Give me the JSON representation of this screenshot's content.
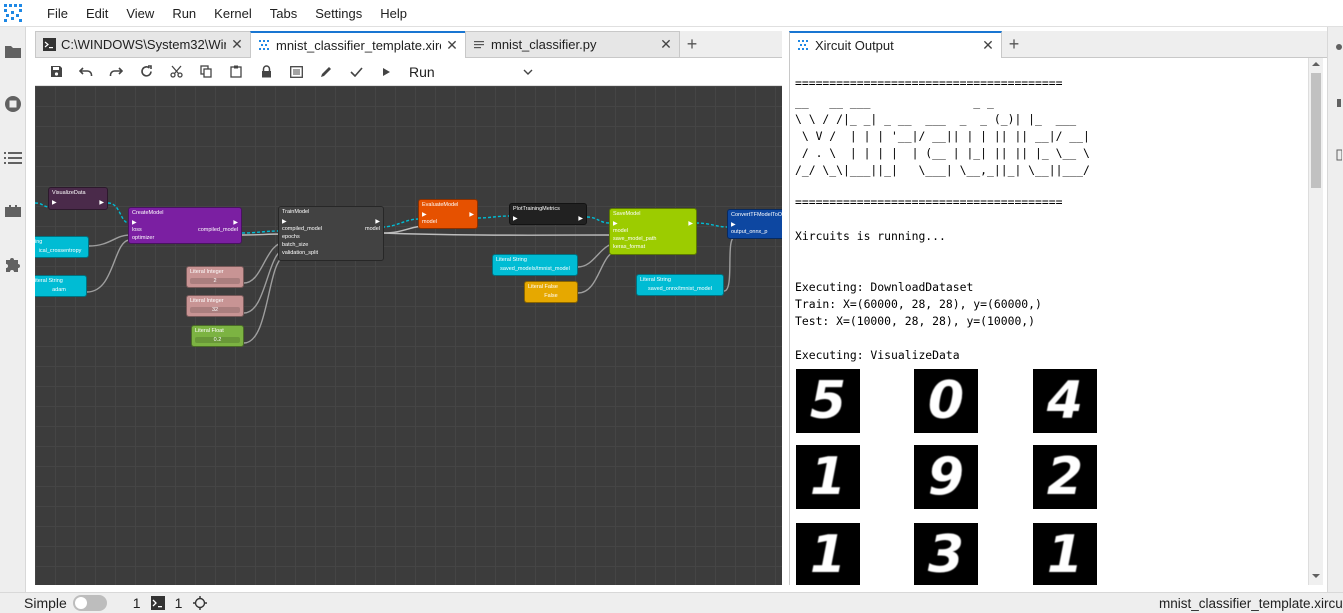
{
  "menu": [
    "File",
    "Edit",
    "View",
    "Run",
    "Kernel",
    "Tabs",
    "Settings",
    "Help"
  ],
  "left_tabs": [
    {
      "label": "C:\\WINDOWS\\System32\\Wir",
      "icon": "terminal-icon",
      "active": false
    },
    {
      "label": "mnist_classifier_template.xirc",
      "icon": "xircuits-icon",
      "active": true
    },
    {
      "label": "mnist_classifier.py",
      "icon": "file-text-icon",
      "active": false
    }
  ],
  "right_tabs": [
    {
      "label": "Xircuit Output",
      "icon": "xircuits-icon",
      "active": true
    }
  ],
  "toolbar": {
    "icons": [
      "save-icon",
      "undo-icon",
      "redo-icon",
      "reload-icon",
      "cut-icon",
      "copy-icon",
      "paste-icon",
      "lock-icon",
      "log-icon",
      "edit-icon",
      "check-icon",
      "play-icon"
    ],
    "run_select_value": "Run"
  },
  "nodes": {
    "visualize": {
      "title": "VisualizeData"
    },
    "create_model": {
      "title": "CreateModel",
      "in1": "loss",
      "in2": "optimizer",
      "out": "compiled_model"
    },
    "lit_string_1": {
      "label": "ing",
      "value": "ical_crossentropy"
    },
    "lit_string_2": {
      "label": "iteral String",
      "value": "adam"
    },
    "train_model": {
      "title": "TrainModel",
      "rows": [
        "compiled_model",
        "epochs",
        "batch_size",
        "validation_split"
      ],
      "out": "model"
    },
    "lit_int_1": {
      "label": "Literal Integer",
      "value": "2"
    },
    "lit_int_2": {
      "label": "Literal Integer",
      "value": "32"
    },
    "lit_float": {
      "label": "Literal Float",
      "value": "0.2"
    },
    "evaluate": {
      "title": "EvaluateModel",
      "in": "model"
    },
    "plot": {
      "title": "PlotTrainingMetrics"
    },
    "save": {
      "title": "SaveModel",
      "rows": [
        "model",
        "save_model_path",
        "keras_format"
      ]
    },
    "lit_string_3": {
      "label": "Literal String",
      "value": "saved_models/tmnist_model"
    },
    "lit_false": {
      "label": "Literal False",
      "value": "False"
    },
    "lit_string_4": {
      "label": "Literal String",
      "value": "saved_onnx/tmnist_model"
    },
    "convert": {
      "title": "ConvertTFModelToOnnx",
      "in": "output_onnx_p"
    }
  },
  "output": {
    "line_eq": "=======================================",
    "ascii_art": [
      "__   __ ___               _ _",
      "\\ \\ / /|_ _| _ __  ___  _  _ (_)| |_  ___",
      " \\ V /  | | | '__|/ __|| | | || || __|/ __|",
      " / . \\  | | | |  | (__ | |_| || || |_ \\__ \\",
      "/_/ \\_\\|___||_|   \\___| \\__,_||_| \\__||___/"
    ],
    "running": "Xircuits is running...",
    "exec1": "Executing: DownloadDataset",
    "train": "Train: X=(60000, 28, 28), y=(60000,)",
    "test": "Test: X=(10000, 28, 28), y=(10000,)",
    "exec2": "Executing: VisualizeData",
    "digits": [
      "5",
      "0",
      "4",
      "1",
      "9",
      "2",
      "1",
      "3",
      "1"
    ]
  },
  "status": {
    "mode_label": "Simple",
    "kernels": "1",
    "terminals": "1",
    "filename": "mnist_classifier_template.xircuits"
  },
  "colors": {
    "accent": "#1976d2",
    "canvas_bg": "#3c3c3c",
    "link_blue": "#00bcd4",
    "create_model": "#7b1fa2",
    "evaluate": "#e65100",
    "save": "#9ccc00",
    "convert": "#0d47a1",
    "literal_string": "#00bcd4",
    "literal_integer": "#c89494",
    "literal_float": "#7cb342",
    "literal_bool": "#e6a800"
  }
}
